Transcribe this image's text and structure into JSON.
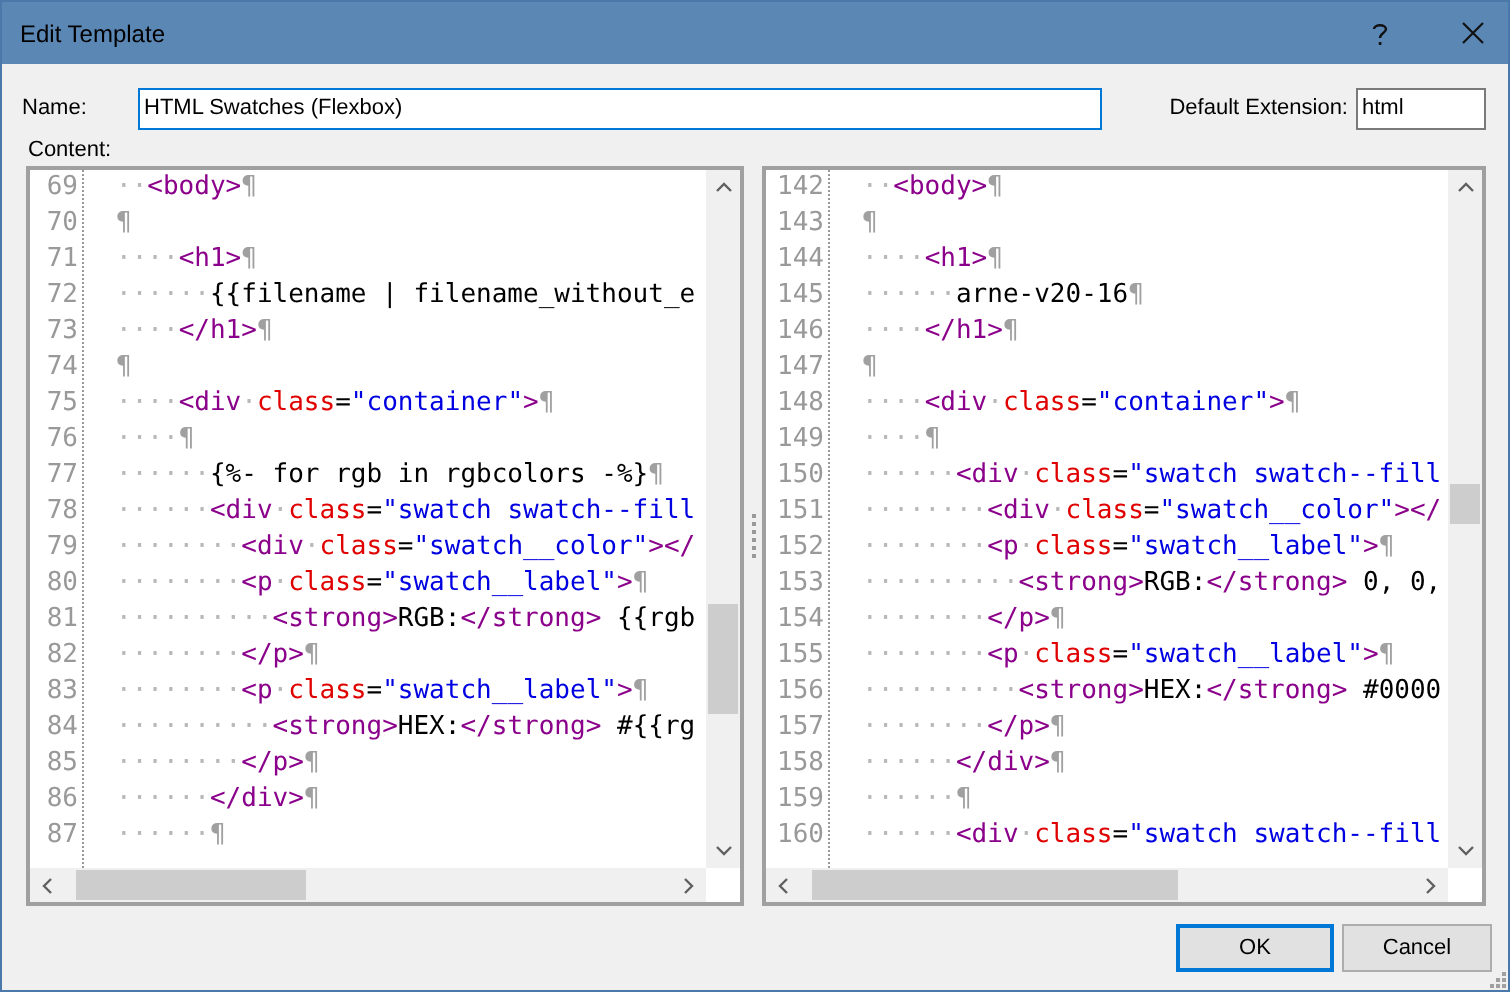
{
  "window": {
    "title": "Edit Template"
  },
  "name_field": {
    "label": "Name:",
    "value": "HTML Swatches (Flexbox)"
  },
  "extension_field": {
    "label": "Default Extension:",
    "value": "html"
  },
  "content_label": "Content:",
  "editors": [
    {
      "lines": [
        {
          "number": "69",
          "tokens": [
            {
              "kind": "ws",
              "text": "··"
            },
            {
              "kind": "tag",
              "text": "<body>"
            },
            {
              "kind": "mark",
              "text": "¶"
            }
          ]
        },
        {
          "number": "70",
          "tokens": [
            {
              "kind": "mark",
              "text": "¶"
            }
          ]
        },
        {
          "number": "71",
          "tokens": [
            {
              "kind": "ws",
              "text": "····"
            },
            {
              "kind": "tag",
              "text": "<h1>"
            },
            {
              "kind": "mark",
              "text": "¶"
            }
          ]
        },
        {
          "number": "72",
          "tokens": [
            {
              "kind": "ws",
              "text": "······"
            },
            {
              "kind": "text",
              "text": "{{filename | filename_without_e"
            }
          ]
        },
        {
          "number": "73",
          "tokens": [
            {
              "kind": "ws",
              "text": "····"
            },
            {
              "kind": "tag",
              "text": "</h1>"
            },
            {
              "kind": "mark",
              "text": "¶"
            }
          ]
        },
        {
          "number": "74",
          "tokens": [
            {
              "kind": "mark",
              "text": "¶"
            }
          ]
        },
        {
          "number": "75",
          "tokens": [
            {
              "kind": "ws",
              "text": "····"
            },
            {
              "kind": "tag",
              "text": "<div"
            },
            {
              "kind": "ws",
              "text": "·"
            },
            {
              "kind": "attr",
              "text": "class"
            },
            {
              "kind": "text",
              "text": "="
            },
            {
              "kind": "value",
              "text": "\"container\""
            },
            {
              "kind": "tag",
              "text": ">"
            },
            {
              "kind": "mark",
              "text": "¶"
            }
          ]
        },
        {
          "number": "76",
          "tokens": [
            {
              "kind": "ws",
              "text": "····"
            },
            {
              "kind": "mark",
              "text": "¶"
            }
          ]
        },
        {
          "number": "77",
          "tokens": [
            {
              "kind": "ws",
              "text": "······"
            },
            {
              "kind": "text",
              "text": "{%- for rgb in rgbcolors -%}"
            },
            {
              "kind": "mark",
              "text": "¶"
            }
          ]
        },
        {
          "number": "78",
          "tokens": [
            {
              "kind": "ws",
              "text": "······"
            },
            {
              "kind": "tag",
              "text": "<div"
            },
            {
              "kind": "ws",
              "text": "·"
            },
            {
              "kind": "attr",
              "text": "class"
            },
            {
              "kind": "text",
              "text": "="
            },
            {
              "kind": "value",
              "text": "\"swatch swatch--fill"
            }
          ]
        },
        {
          "number": "79",
          "tokens": [
            {
              "kind": "ws",
              "text": "········"
            },
            {
              "kind": "tag",
              "text": "<div"
            },
            {
              "kind": "ws",
              "text": "·"
            },
            {
              "kind": "attr",
              "text": "class"
            },
            {
              "kind": "text",
              "text": "="
            },
            {
              "kind": "value",
              "text": "\"swatch__color\""
            },
            {
              "kind": "tag",
              "text": "></"
            }
          ]
        },
        {
          "number": "80",
          "tokens": [
            {
              "kind": "ws",
              "text": "········"
            },
            {
              "kind": "tag",
              "text": "<p"
            },
            {
              "kind": "ws",
              "text": "·"
            },
            {
              "kind": "attr",
              "text": "class"
            },
            {
              "kind": "text",
              "text": "="
            },
            {
              "kind": "value",
              "text": "\"swatch__label\""
            },
            {
              "kind": "tag",
              "text": ">"
            },
            {
              "kind": "mark",
              "text": "¶"
            }
          ]
        },
        {
          "number": "81",
          "tokens": [
            {
              "kind": "ws",
              "text": "··········"
            },
            {
              "kind": "tag",
              "text": "<strong>"
            },
            {
              "kind": "text",
              "text": "RGB:"
            },
            {
              "kind": "tag",
              "text": "</strong>"
            },
            {
              "kind": "text",
              "text": " {{rgb"
            }
          ]
        },
        {
          "number": "82",
          "tokens": [
            {
              "kind": "ws",
              "text": "········"
            },
            {
              "kind": "tag",
              "text": "</p>"
            },
            {
              "kind": "mark",
              "text": "¶"
            }
          ]
        },
        {
          "number": "83",
          "tokens": [
            {
              "kind": "ws",
              "text": "········"
            },
            {
              "kind": "tag",
              "text": "<p"
            },
            {
              "kind": "ws",
              "text": "·"
            },
            {
              "kind": "attr",
              "text": "class"
            },
            {
              "kind": "text",
              "text": "="
            },
            {
              "kind": "value",
              "text": "\"swatch__label\""
            },
            {
              "kind": "tag",
              "text": ">"
            },
            {
              "kind": "mark",
              "text": "¶"
            }
          ]
        },
        {
          "number": "84",
          "tokens": [
            {
              "kind": "ws",
              "text": "··········"
            },
            {
              "kind": "tag",
              "text": "<strong>"
            },
            {
              "kind": "text",
              "text": "HEX:"
            },
            {
              "kind": "tag",
              "text": "</strong>"
            },
            {
              "kind": "text",
              "text": " #{{rg"
            }
          ]
        },
        {
          "number": "85",
          "tokens": [
            {
              "kind": "ws",
              "text": "········"
            },
            {
              "kind": "tag",
              "text": "</p>"
            },
            {
              "kind": "mark",
              "text": "¶"
            }
          ]
        },
        {
          "number": "86",
          "tokens": [
            {
              "kind": "ws",
              "text": "······"
            },
            {
              "kind": "tag",
              "text": "</div>"
            },
            {
              "kind": "mark",
              "text": "¶"
            }
          ]
        },
        {
          "number": "87",
          "tokens": [
            {
              "kind": "ws",
              "text": "······"
            },
            {
              "kind": "mark",
              "text": "¶"
            }
          ]
        }
      ]
    },
    {
      "lines": [
        {
          "number": "142",
          "tokens": [
            {
              "kind": "ws",
              "text": "··"
            },
            {
              "kind": "tag",
              "text": "<body>"
            },
            {
              "kind": "mark",
              "text": "¶"
            }
          ]
        },
        {
          "number": "143",
          "tokens": [
            {
              "kind": "mark",
              "text": "¶"
            }
          ]
        },
        {
          "number": "144",
          "tokens": [
            {
              "kind": "ws",
              "text": "····"
            },
            {
              "kind": "tag",
              "text": "<h1>"
            },
            {
              "kind": "mark",
              "text": "¶"
            }
          ]
        },
        {
          "number": "145",
          "tokens": [
            {
              "kind": "ws",
              "text": "······"
            },
            {
              "kind": "text",
              "text": "arne-v20-16"
            },
            {
              "kind": "mark",
              "text": "¶"
            }
          ]
        },
        {
          "number": "146",
          "tokens": [
            {
              "kind": "ws",
              "text": "····"
            },
            {
              "kind": "tag",
              "text": "</h1>"
            },
            {
              "kind": "mark",
              "text": "¶"
            }
          ]
        },
        {
          "number": "147",
          "tokens": [
            {
              "kind": "mark",
              "text": "¶"
            }
          ]
        },
        {
          "number": "148",
          "tokens": [
            {
              "kind": "ws",
              "text": "····"
            },
            {
              "kind": "tag",
              "text": "<div"
            },
            {
              "kind": "ws",
              "text": "·"
            },
            {
              "kind": "attr",
              "text": "class"
            },
            {
              "kind": "text",
              "text": "="
            },
            {
              "kind": "value",
              "text": "\"container\""
            },
            {
              "kind": "tag",
              "text": ">"
            },
            {
              "kind": "mark",
              "text": "¶"
            }
          ]
        },
        {
          "number": "149",
          "tokens": [
            {
              "kind": "ws",
              "text": "····"
            },
            {
              "kind": "mark",
              "text": "¶"
            }
          ]
        },
        {
          "number": "150",
          "tokens": [
            {
              "kind": "ws",
              "text": "······"
            },
            {
              "kind": "tag",
              "text": "<div"
            },
            {
              "kind": "ws",
              "text": "·"
            },
            {
              "kind": "attr",
              "text": "class"
            },
            {
              "kind": "text",
              "text": "="
            },
            {
              "kind": "value",
              "text": "\"swatch swatch--fill"
            }
          ]
        },
        {
          "number": "151",
          "tokens": [
            {
              "kind": "ws",
              "text": "········"
            },
            {
              "kind": "tag",
              "text": "<div"
            },
            {
              "kind": "ws",
              "text": "·"
            },
            {
              "kind": "attr",
              "text": "class"
            },
            {
              "kind": "text",
              "text": "="
            },
            {
              "kind": "value",
              "text": "\"swatch__color\""
            },
            {
              "kind": "tag",
              "text": "></"
            }
          ]
        },
        {
          "number": "152",
          "tokens": [
            {
              "kind": "ws",
              "text": "········"
            },
            {
              "kind": "tag",
              "text": "<p"
            },
            {
              "kind": "ws",
              "text": "·"
            },
            {
              "kind": "attr",
              "text": "class"
            },
            {
              "kind": "text",
              "text": "="
            },
            {
              "kind": "value",
              "text": "\"swatch__label\""
            },
            {
              "kind": "tag",
              "text": ">"
            },
            {
              "kind": "mark",
              "text": "¶"
            }
          ]
        },
        {
          "number": "153",
          "tokens": [
            {
              "kind": "ws",
              "text": "··········"
            },
            {
              "kind": "tag",
              "text": "<strong>"
            },
            {
              "kind": "text",
              "text": "RGB:"
            },
            {
              "kind": "tag",
              "text": "</strong>"
            },
            {
              "kind": "text",
              "text": " 0, 0,"
            }
          ]
        },
        {
          "number": "154",
          "tokens": [
            {
              "kind": "ws",
              "text": "········"
            },
            {
              "kind": "tag",
              "text": "</p>"
            },
            {
              "kind": "mark",
              "text": "¶"
            }
          ]
        },
        {
          "number": "155",
          "tokens": [
            {
              "kind": "ws",
              "text": "········"
            },
            {
              "kind": "tag",
              "text": "<p"
            },
            {
              "kind": "ws",
              "text": "·"
            },
            {
              "kind": "attr",
              "text": "class"
            },
            {
              "kind": "text",
              "text": "="
            },
            {
              "kind": "value",
              "text": "\"swatch__label\""
            },
            {
              "kind": "tag",
              "text": ">"
            },
            {
              "kind": "mark",
              "text": "¶"
            }
          ]
        },
        {
          "number": "156",
          "tokens": [
            {
              "kind": "ws",
              "text": "··········"
            },
            {
              "kind": "tag",
              "text": "<strong>"
            },
            {
              "kind": "text",
              "text": "HEX:"
            },
            {
              "kind": "tag",
              "text": "</strong>"
            },
            {
              "kind": "text",
              "text": " #0000"
            }
          ]
        },
        {
          "number": "157",
          "tokens": [
            {
              "kind": "ws",
              "text": "········"
            },
            {
              "kind": "tag",
              "text": "</p>"
            },
            {
              "kind": "mark",
              "text": "¶"
            }
          ]
        },
        {
          "number": "158",
          "tokens": [
            {
              "kind": "ws",
              "text": "······"
            },
            {
              "kind": "tag",
              "text": "</div>"
            },
            {
              "kind": "mark",
              "text": "¶"
            }
          ]
        },
        {
          "number": "159",
          "tokens": [
            {
              "kind": "ws",
              "text": "······"
            },
            {
              "kind": "mark",
              "text": "¶"
            }
          ]
        },
        {
          "number": "160",
          "tokens": [
            {
              "kind": "ws",
              "text": "······"
            },
            {
              "kind": "tag",
              "text": "<div"
            },
            {
              "kind": "ws",
              "text": "·"
            },
            {
              "kind": "attr",
              "text": "class"
            },
            {
              "kind": "text",
              "text": "="
            },
            {
              "kind": "value",
              "text": "\"swatch swatch--fill"
            }
          ]
        }
      ]
    }
  ],
  "buttons": [
    {
      "label": "OK",
      "kind": "default"
    },
    {
      "label": "Cancel",
      "kind": "normal"
    }
  ]
}
